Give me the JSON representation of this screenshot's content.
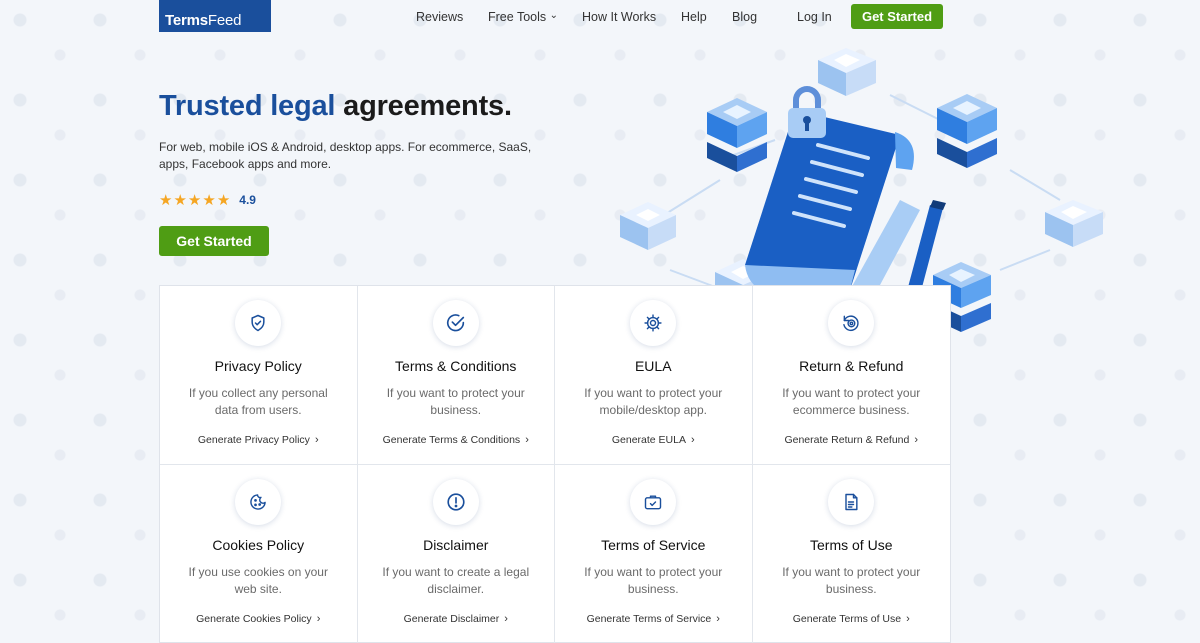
{
  "brand": {
    "logo_bold": "Terms",
    "logo_light": "Feed"
  },
  "nav": {
    "items": [
      {
        "label": "Reviews"
      },
      {
        "label": "Free Tools"
      },
      {
        "label": "How It Works"
      },
      {
        "label": "Help"
      },
      {
        "label": "Blog"
      },
      {
        "label": "Log In"
      }
    ],
    "dropdown_caret": "⌄",
    "cta": "Get Started"
  },
  "hero": {
    "title_accent": "Trusted legal",
    "title_rest": " agreements.",
    "subtitle": "For web, mobile iOS & Android, desktop apps. For ecommerce, SaaS, apps, Facebook apps and more.",
    "rating_value": "4.9",
    "stars": 5,
    "cta": "Get Started"
  },
  "colors": {
    "brand_blue": "#1a4f9c",
    "cta_green": "#4f9d14",
    "star": "#f5a623"
  },
  "cards": [
    {
      "icon": "shield-check-icon",
      "title": "Privacy Policy",
      "desc": "If you collect any personal data from users.",
      "link": "Generate Privacy Policy"
    },
    {
      "icon": "check-circle-icon",
      "title": "Terms & Conditions",
      "desc": "If you want to protect your business.",
      "link": "Generate Terms & Conditions"
    },
    {
      "icon": "gear-icon",
      "title": "EULA",
      "desc": "If you want to protect your mobile/desktop app.",
      "link": "Generate EULA"
    },
    {
      "icon": "refund-icon",
      "title": "Return & Refund",
      "desc": "If you want to protect your ecommerce business.",
      "link": "Generate Return & Refund"
    },
    {
      "icon": "cookie-icon",
      "title": "Cookies Policy",
      "desc": "If you use cookies on your web site.",
      "link": "Generate Cookies Policy"
    },
    {
      "icon": "alert-icon",
      "title": "Disclaimer",
      "desc": "If you want to create a legal disclaimer.",
      "link": "Generate Disclaimer"
    },
    {
      "icon": "briefcase-icon",
      "title": "Terms of Service",
      "desc": "If you want to protect your business.",
      "link": "Generate Terms of Service"
    },
    {
      "icon": "document-icon",
      "title": "Terms of Use",
      "desc": "If you want to protect your business.",
      "link": "Generate Terms of Use"
    }
  ],
  "link_chevron": "›"
}
